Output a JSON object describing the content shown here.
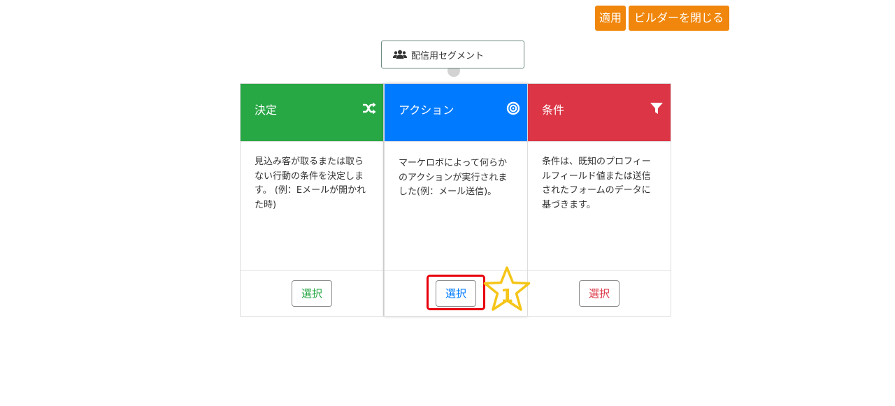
{
  "toolbar": {
    "apply_label": "適用",
    "close_builder_label": "ビルダーを閉じる",
    "button_color": "#f0860b"
  },
  "segment": {
    "icon": "users-icon",
    "label": "配信用セグメント"
  },
  "cards": [
    {
      "id": "decision",
      "title": "決定",
      "icon": "shuffle-icon",
      "color": "#28a745",
      "description": "見込み客が取るまたは取らない行動の条件を決定します。 (例：Eメールが開かれた時)",
      "select_label": "選択"
    },
    {
      "id": "action",
      "title": "アクション",
      "icon": "bullseye-icon",
      "color": "#007bff",
      "description": "マーケロボによって何らかのアクションが実行されました(例：メール送信)。",
      "select_label": "選択"
    },
    {
      "id": "condition",
      "title": "条件",
      "icon": "filter-icon",
      "color": "#dc3545",
      "description": "条件は、既知のプロフィールフィールド値または送信されたフォームのデータに基づきます。",
      "select_label": "選択"
    }
  ],
  "annotation": {
    "step_number": "1",
    "highlight_color": "#e8000b",
    "star_color": "#f5c518"
  }
}
